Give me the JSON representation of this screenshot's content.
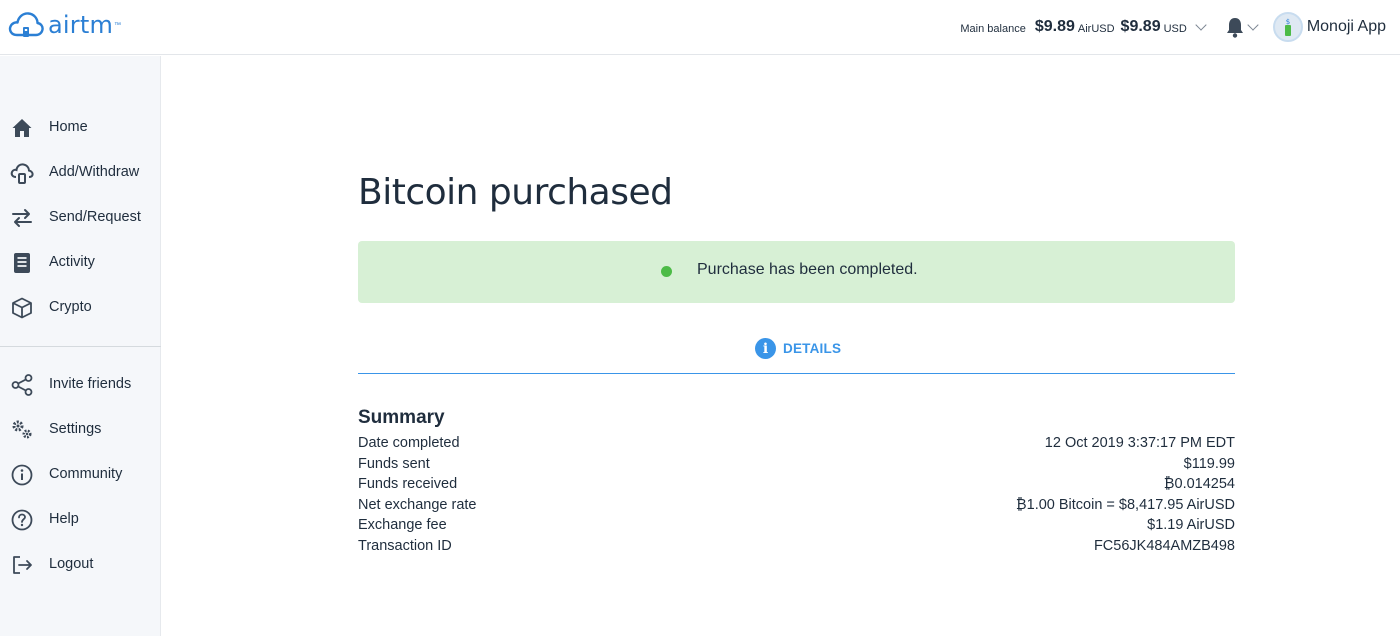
{
  "brand": {
    "logo_text": "airtm",
    "logo_tm": "™",
    "accent": "#2b7fd4"
  },
  "header": {
    "balance_label": "Main balance",
    "balance_airusd": "$9.89",
    "airusd_unit": "AirUSD",
    "balance_usd": "$9.89",
    "usd_unit": "USD",
    "user_name": "Monoji App"
  },
  "sidebar": {
    "items": [
      {
        "label": "Home",
        "icon": "home-icon"
      },
      {
        "label": "Add/Withdraw",
        "icon": "cloud-transfer-icon"
      },
      {
        "label": "Send/Request",
        "icon": "arrows-exchange-icon"
      },
      {
        "label": "Activity",
        "icon": "document-list-icon"
      },
      {
        "label": "Crypto",
        "icon": "cube-icon"
      },
      {
        "label": "Invite friends",
        "icon": "share-icon"
      },
      {
        "label": "Settings",
        "icon": "gears-icon"
      },
      {
        "label": "Community",
        "icon": "info-circle-icon"
      },
      {
        "label": "Help",
        "icon": "question-circle-icon"
      },
      {
        "label": "Logout",
        "icon": "logout-icon"
      }
    ]
  },
  "main": {
    "title": "Bitcoin purchased",
    "alert": {
      "text": "Purchase has been completed.",
      "color": "#d7f0d5",
      "dot_color": "#4cbb47"
    },
    "tab": {
      "label": "DETAILS",
      "icon_glyph": "i",
      "color": "#3a95e8"
    },
    "summary": {
      "title": "Summary",
      "rows": [
        {
          "label": "Date completed",
          "value": "12 Oct 2019 3:37:17 PM EDT"
        },
        {
          "label": "Funds sent",
          "value": "$119.99"
        },
        {
          "label": "Funds received",
          "value": "₿0.014254"
        },
        {
          "label": "Net exchange rate",
          "value": "₿1.00 Bitcoin = $8,417.95 AirUSD"
        },
        {
          "label": "Exchange fee",
          "value": "$1.19 AirUSD"
        },
        {
          "label": "Transaction ID",
          "value": "FC56JK484AMZB498"
        }
      ]
    }
  }
}
